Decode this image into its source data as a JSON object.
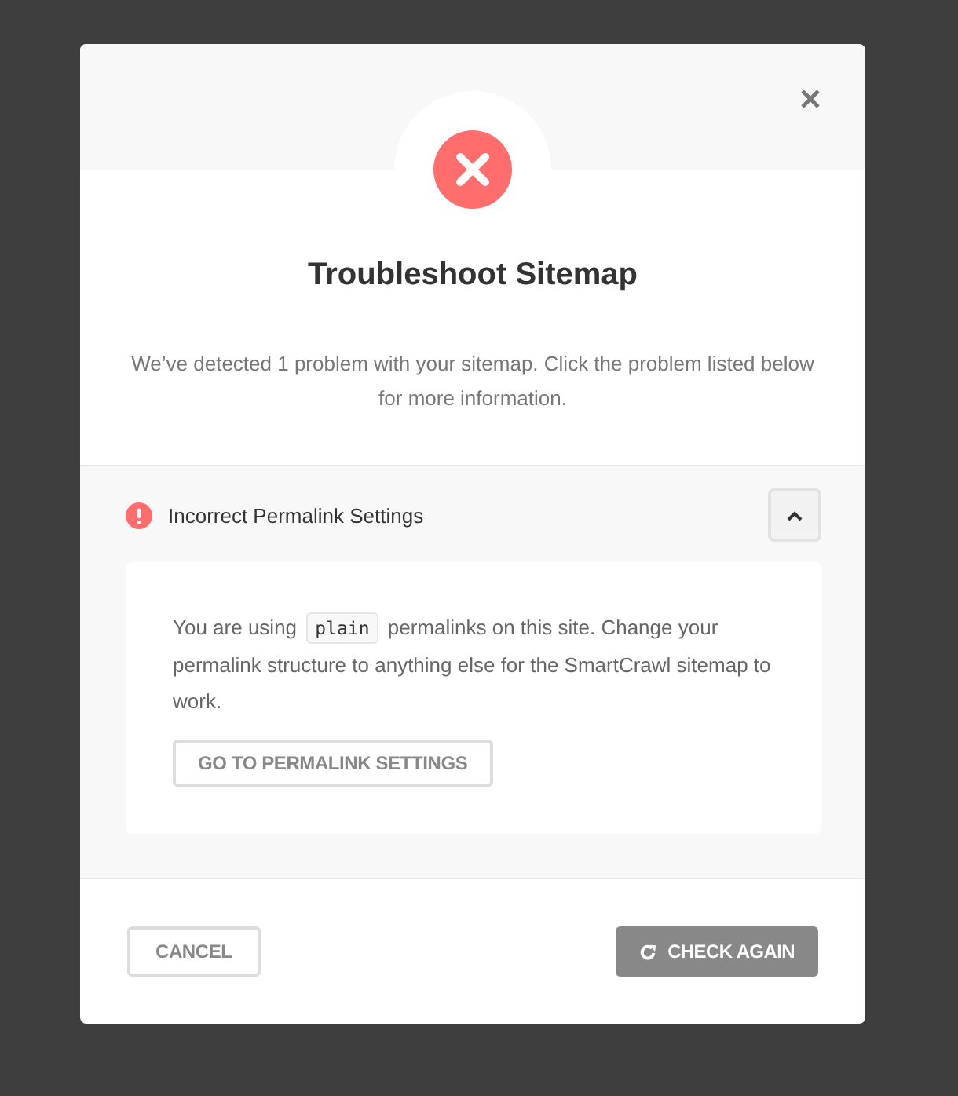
{
  "dialog": {
    "title": "Troubleshoot Sitemap",
    "message": "We’ve detected 1 problem with your sitemap. Click the problem listed below for more information."
  },
  "issues": [
    {
      "title": "Incorrect Permalink Settings",
      "expanded": true,
      "text_before": "You are using",
      "code": "plain",
      "text_after": "permalinks on this site. Change your permalink structure to anything else for the SmartCrawl sitemap to work.",
      "action": "GO TO PERMALINK SETTINGS"
    }
  ],
  "footer": {
    "cancel": "CANCEL",
    "check_again": "CHECK AGAIN"
  }
}
